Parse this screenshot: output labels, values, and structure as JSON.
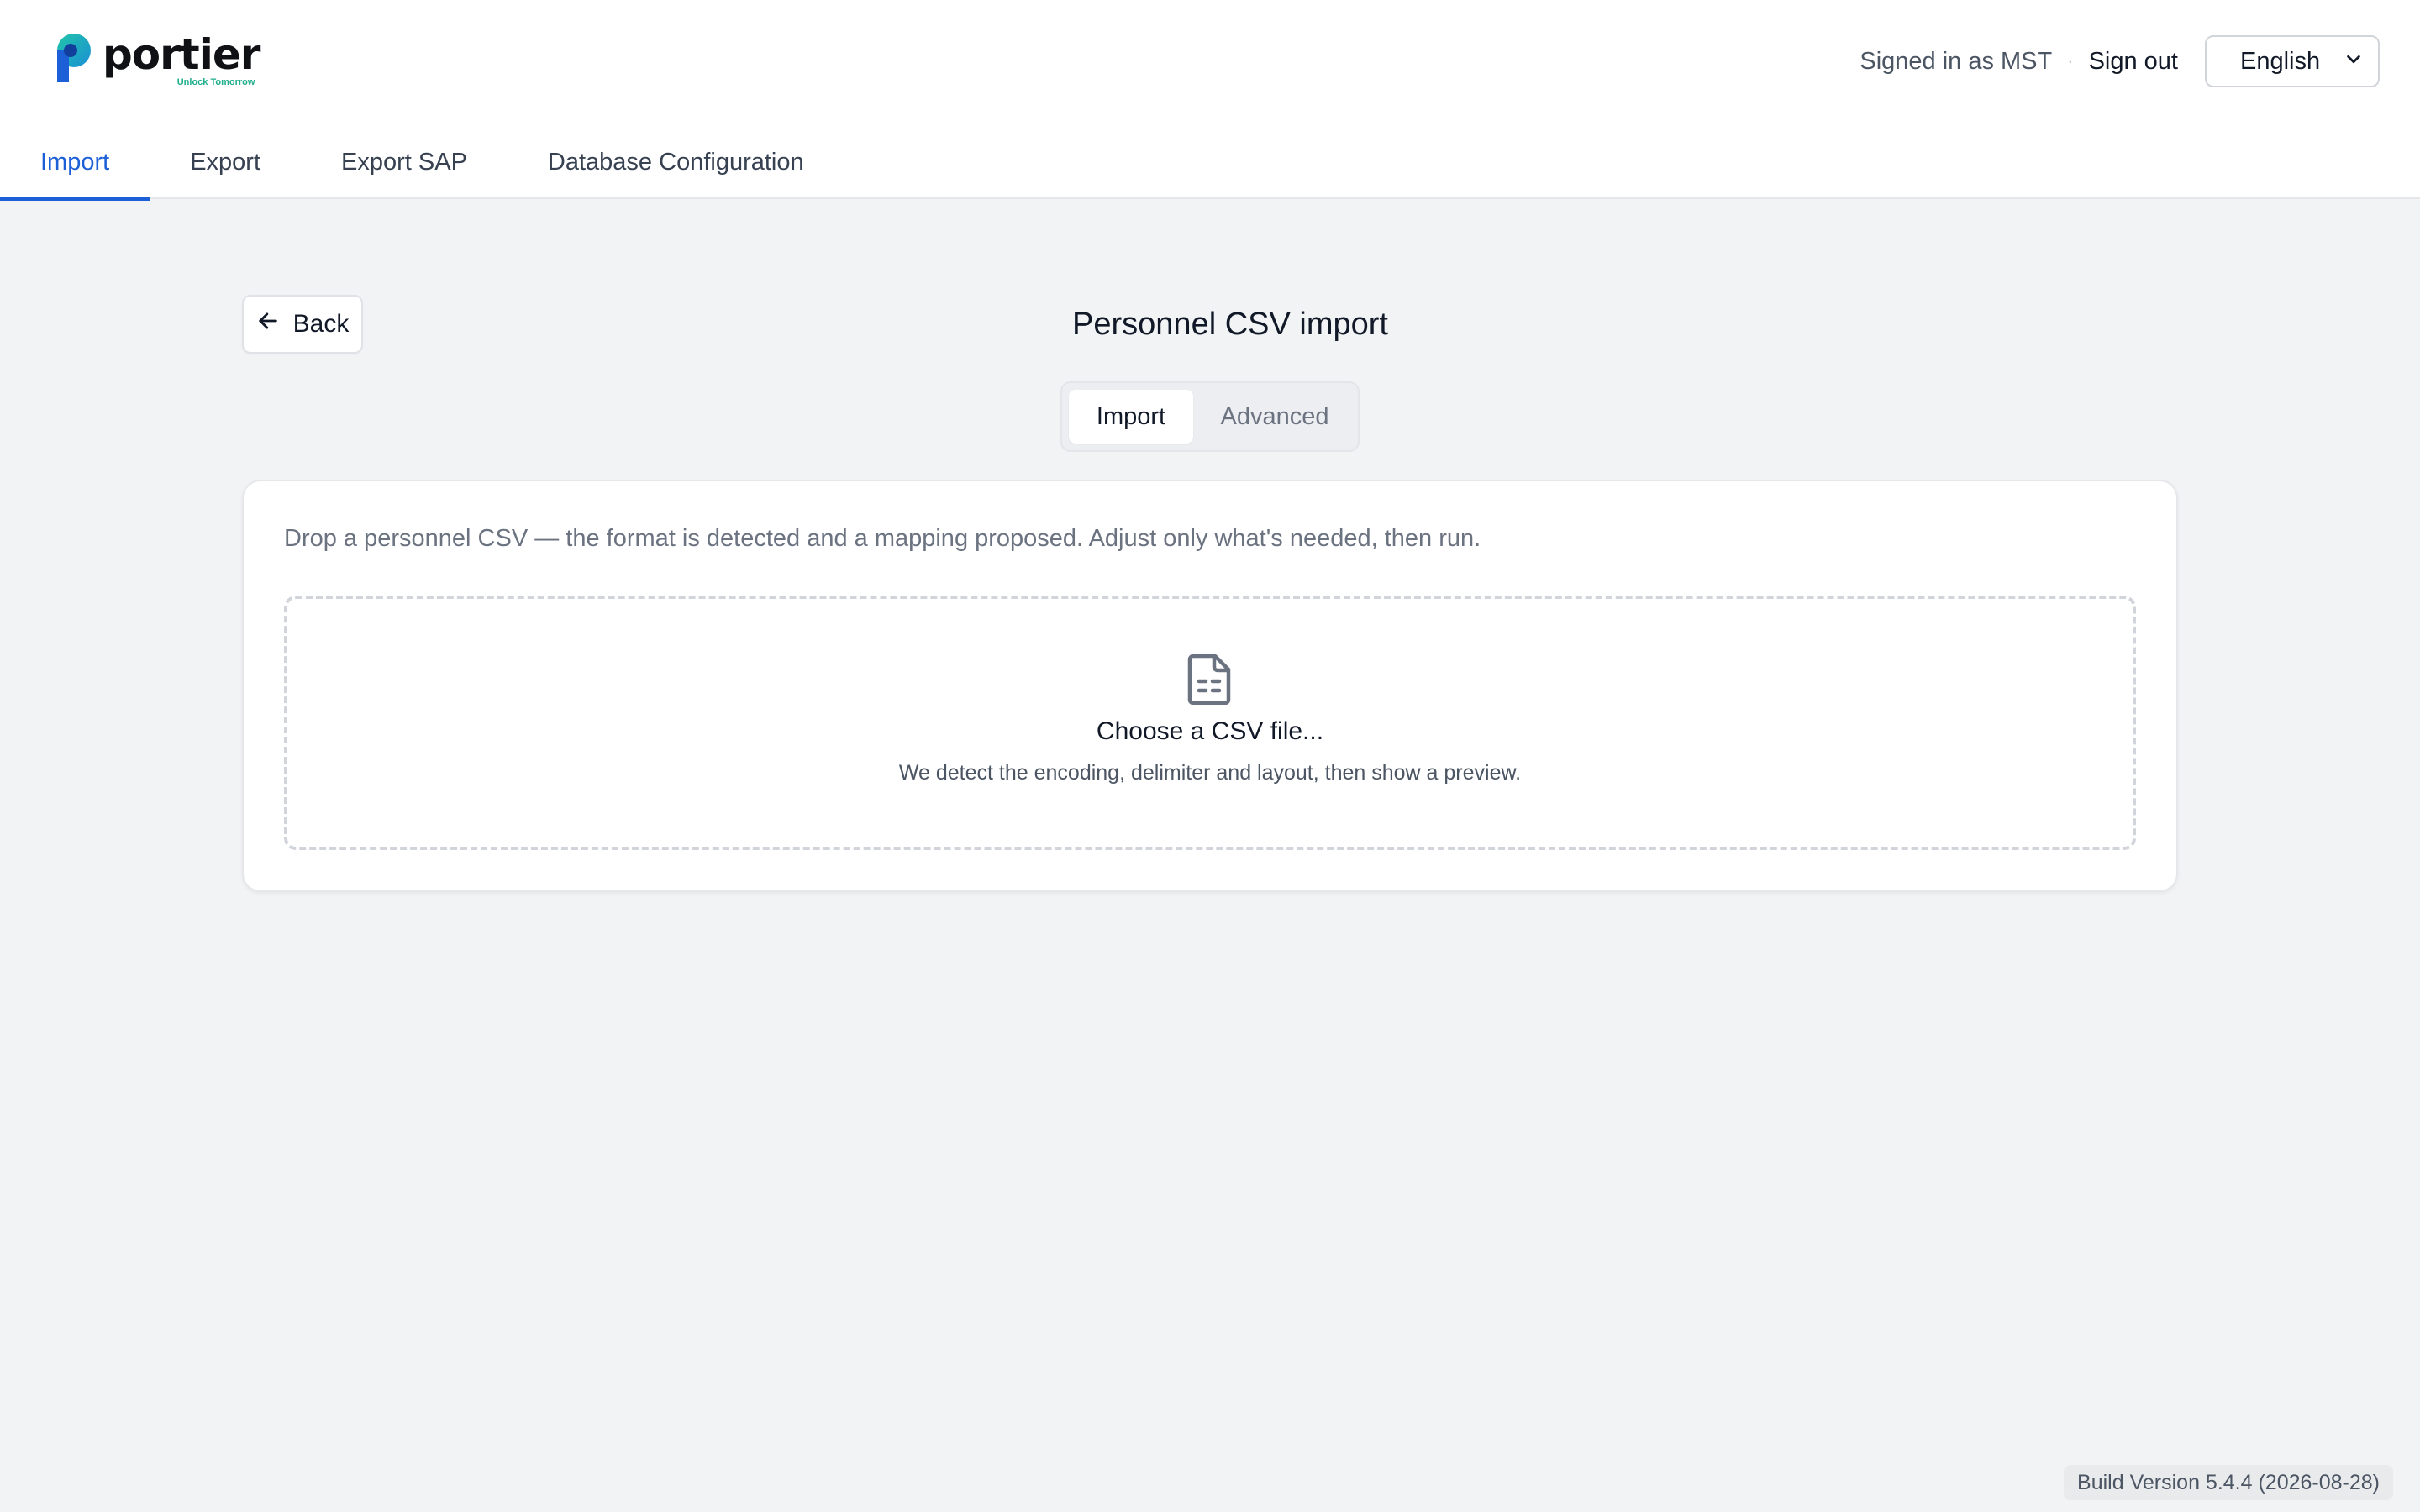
{
  "brand": {
    "name": "portier",
    "tagline": "Unlock Tomorrow",
    "colors": {
      "primary_blue": "#1d5fd6",
      "teal": "#1fae8c"
    }
  },
  "header": {
    "signed_in_text": "Signed in as MST",
    "separator": "·",
    "sign_out_label": "Sign out",
    "language": {
      "selected": "English",
      "icon": "chevron-down-icon"
    }
  },
  "nav": {
    "tabs": [
      {
        "label": "Import",
        "active": true
      },
      {
        "label": "Export",
        "active": false
      },
      {
        "label": "Export SAP",
        "active": false
      },
      {
        "label": "Database Configuration",
        "active": false
      }
    ]
  },
  "page": {
    "back_label": "Back",
    "back_icon": "arrow-left-icon",
    "title": "Personnel CSV import",
    "mode_tabs": [
      {
        "label": "Import",
        "active": true
      },
      {
        "label": "Advanced",
        "active": false
      }
    ]
  },
  "card": {
    "description": "Drop a personnel CSV — the format is detected and a mapping proposed. Adjust only what's needed, then run.",
    "dropzone": {
      "icon": "file-spreadsheet-icon",
      "title": "Choose a CSV file...",
      "hint": "We detect the encoding, delimiter and layout, then show a preview."
    }
  },
  "footer": {
    "build_version": "Build Version 5.4.4 (2026-08-28)"
  }
}
